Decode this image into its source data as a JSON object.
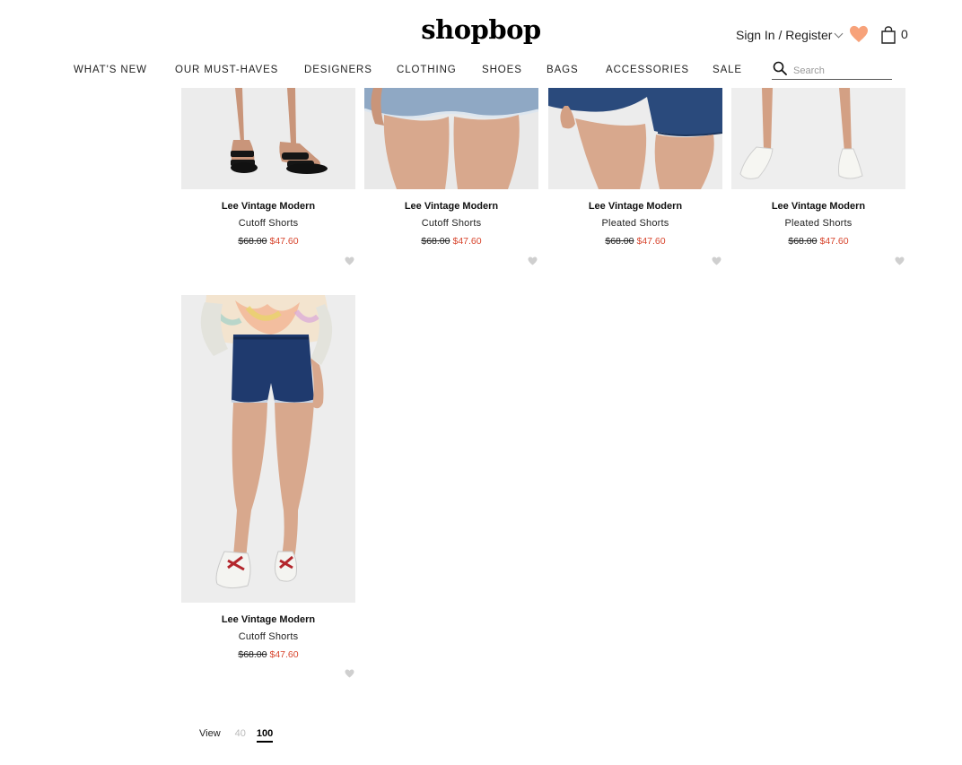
{
  "header": {
    "logo": "shopbop",
    "account": {
      "label": "Sign In / Register",
      "icon": "chevron-down-icon"
    },
    "wishlist": {
      "icon": "heart-icon",
      "color": "#f7a27a"
    },
    "bag": {
      "icon": "shopping-bag-icon",
      "count": "0"
    },
    "search": {
      "placeholder": "Search",
      "value": "",
      "icon": "search-icon"
    }
  },
  "nav": {
    "items": [
      {
        "label": "WHAT'S NEW"
      },
      {
        "label": "OUR MUST-HAVES"
      },
      {
        "label": "DESIGNERS"
      },
      {
        "label": "CLOTHING"
      },
      {
        "label": "SHOES"
      },
      {
        "label": "BAGS"
      },
      {
        "label": "ACCESSORIES"
      },
      {
        "label": "SALE"
      }
    ]
  },
  "products": [
    {
      "brand": "Lee Vintage Modern",
      "name": "Cutoff Shorts",
      "original_price": "$68.00",
      "sale_price": "$47.60"
    },
    {
      "brand": "Lee Vintage Modern",
      "name": "Cutoff Shorts",
      "original_price": "$68.00",
      "sale_price": "$47.60"
    },
    {
      "brand": "Lee Vintage Modern",
      "name": "Pleated Shorts",
      "original_price": "$68.00",
      "sale_price": "$47.60"
    },
    {
      "brand": "Lee Vintage Modern",
      "name": "Pleated Shorts",
      "original_price": "$68.00",
      "sale_price": "$47.60"
    },
    {
      "brand": "Lee Vintage Modern",
      "name": "Cutoff Shorts",
      "original_price": "$68.00",
      "sale_price": "$47.60"
    }
  ],
  "pagination": {
    "view_label": "View",
    "options": [
      "40",
      "100"
    ],
    "selected": "100"
  },
  "colors": {
    "sale_price": "#d8462e",
    "accent_heart": "#f7a27a",
    "wishlist_icon": "#cfcfcf"
  }
}
